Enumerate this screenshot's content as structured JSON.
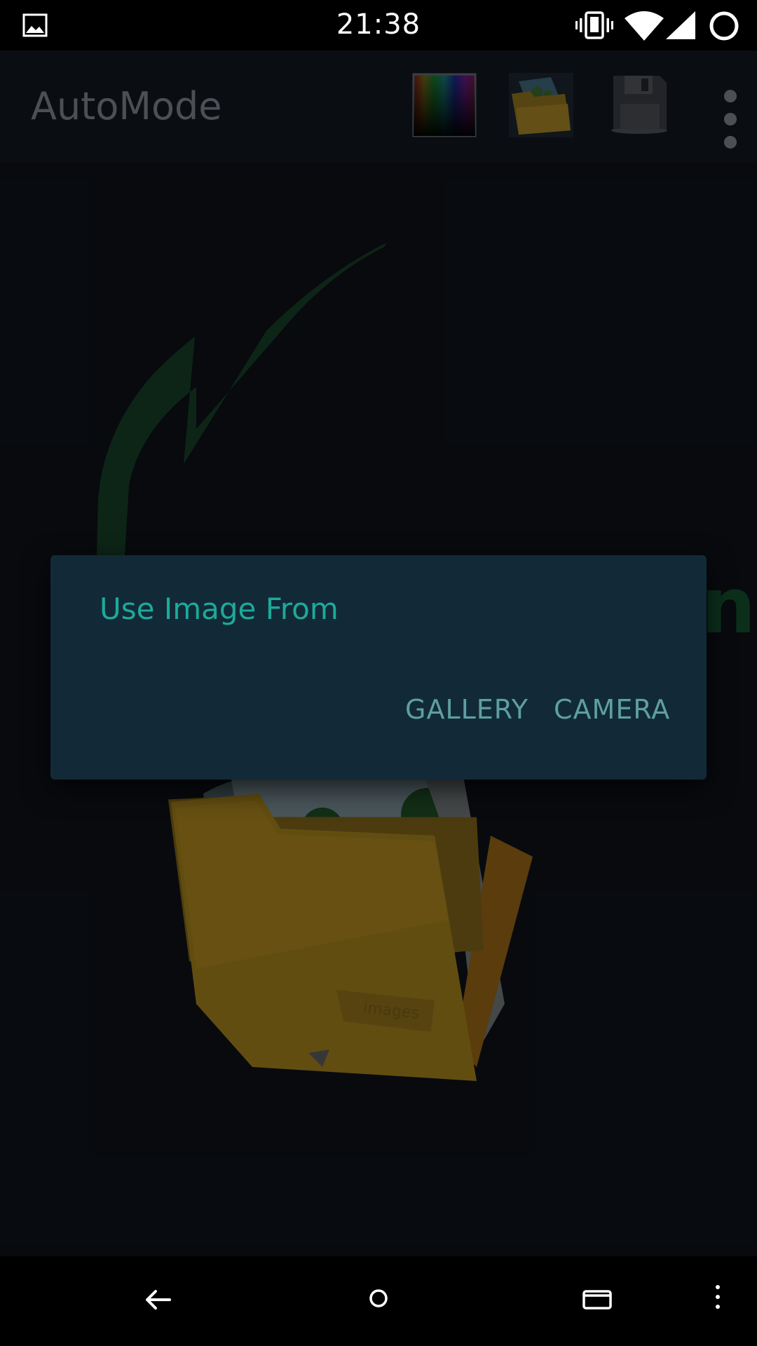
{
  "status_bar": {
    "time": "21:38",
    "icons": [
      "gallery-notification-icon",
      "vibrate-icon",
      "wifi-icon",
      "cell-signal-icon",
      "battery-ring-icon"
    ]
  },
  "app_bar": {
    "title": "AutoMode",
    "actions": [
      "color-picker-icon",
      "image-folder-icon",
      "save-icon",
      "overflow-menu-icon"
    ]
  },
  "dialog": {
    "title": "Use Image From",
    "buttons": {
      "gallery": "GALLERY",
      "camera": "CAMERA"
    }
  },
  "background": {
    "folder_label": "images"
  },
  "nav_bar": {
    "buttons": [
      "back-icon",
      "home-icon",
      "recents-icon",
      "menu-icon"
    ]
  },
  "colors": {
    "dialog_bg": "#122a38",
    "dialog_title": "#1fa99a",
    "dialog_button": "#5e9fa3",
    "app_title": "#5d6166",
    "arrow": "#123a24"
  }
}
